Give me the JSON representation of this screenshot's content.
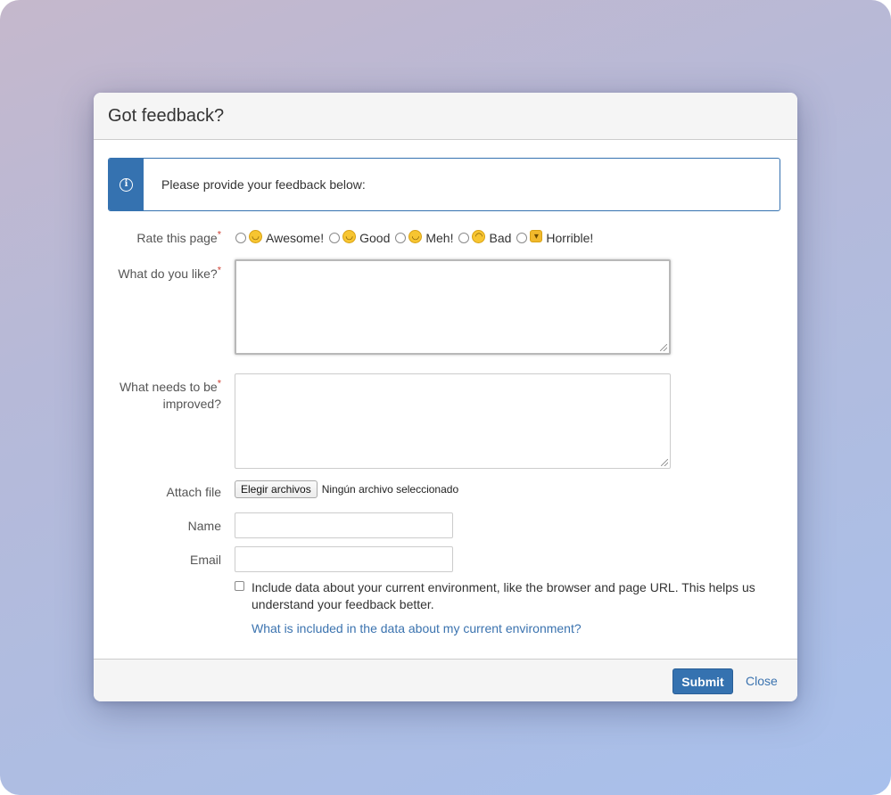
{
  "dialog": {
    "title": "Got feedback?",
    "info_message": "Please provide your feedback below:"
  },
  "form": {
    "rating": {
      "label": "Rate this page",
      "required_mark": "*",
      "options": [
        {
          "label": "Awesome!",
          "icon": "grinning-face-icon",
          "glyph": "😄"
        },
        {
          "label": "Good",
          "icon": "smiling-face-icon",
          "glyph": "🙂"
        },
        {
          "label": "Meh!",
          "icon": "neutral-face-icon",
          "glyph": "😊"
        },
        {
          "label": "Bad",
          "icon": "frowning-face-icon",
          "glyph": "☹"
        },
        {
          "label": "Horrible!",
          "icon": "thumbs-down-icon",
          "glyph": "👎"
        }
      ]
    },
    "like": {
      "label": "What do you like?",
      "required_mark": "*",
      "value": ""
    },
    "improve": {
      "label_line1": "What needs to be",
      "label_line2": "improved?",
      "required_mark": "*",
      "value": ""
    },
    "attach": {
      "label": "Attach file",
      "button_label": "Elegir archivos",
      "status": "Ningún archivo seleccionado"
    },
    "name": {
      "label": "Name",
      "value": ""
    },
    "email": {
      "label": "Email",
      "value": ""
    },
    "environment": {
      "checkbox_text": "Include data about your current environment, like the browser and page URL. This helps us understand your feedback better.",
      "checked": false,
      "link_text": "What is included in the data about my current environment?"
    }
  },
  "footer": {
    "submit_label": "Submit",
    "close_label": "Close"
  },
  "colors": {
    "primary": "#3572b0",
    "link": "#3b73af",
    "required": "#d04437"
  }
}
